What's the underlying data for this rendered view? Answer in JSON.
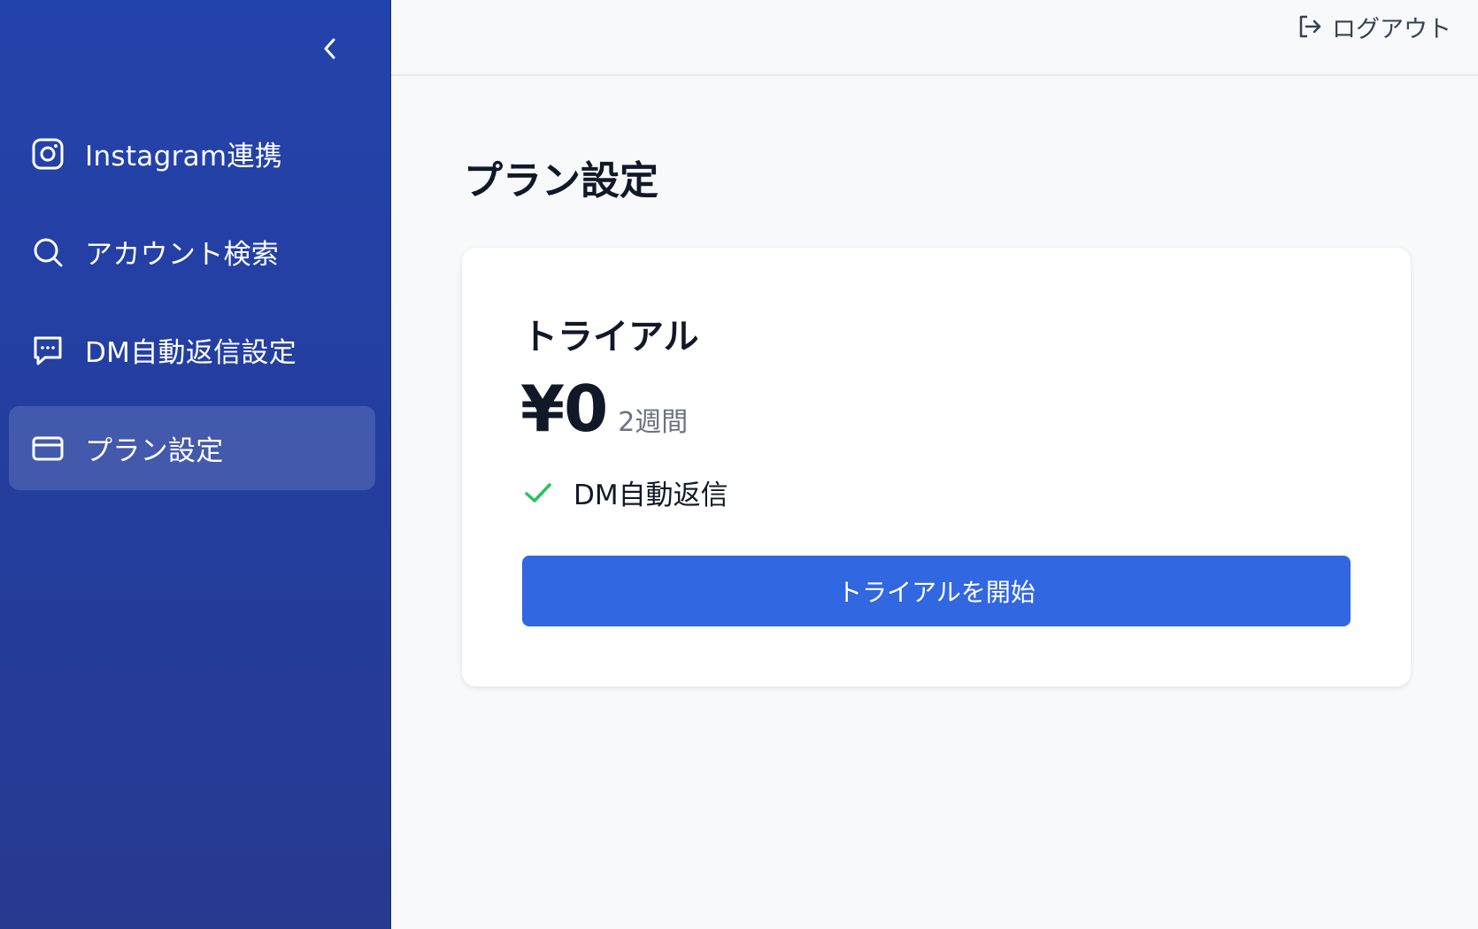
{
  "sidebar": {
    "collapse_icon": "chevron-left-icon",
    "items": [
      {
        "label": "Instagram連携",
        "icon": "instagram-icon"
      },
      {
        "label": "アカウント検索",
        "icon": "search-icon"
      },
      {
        "label": "DM自動返信設定",
        "icon": "message-icon"
      },
      {
        "label": "プラン設定",
        "icon": "credit-card-icon",
        "active": true
      }
    ]
  },
  "topbar": {
    "logout_label": "ログアウト",
    "logout_icon": "logout-icon"
  },
  "main": {
    "title": "プラン設定",
    "plan": {
      "name": "トライアル",
      "price": "¥0",
      "period": "2週間",
      "features": [
        "DM自動返信"
      ],
      "button_label": "トライアルを開始"
    }
  },
  "colors": {
    "sidebar_bg": "#2343ac",
    "primary_button": "#3167e0",
    "check": "#22c55e",
    "page_bg": "#f8f9fb"
  }
}
